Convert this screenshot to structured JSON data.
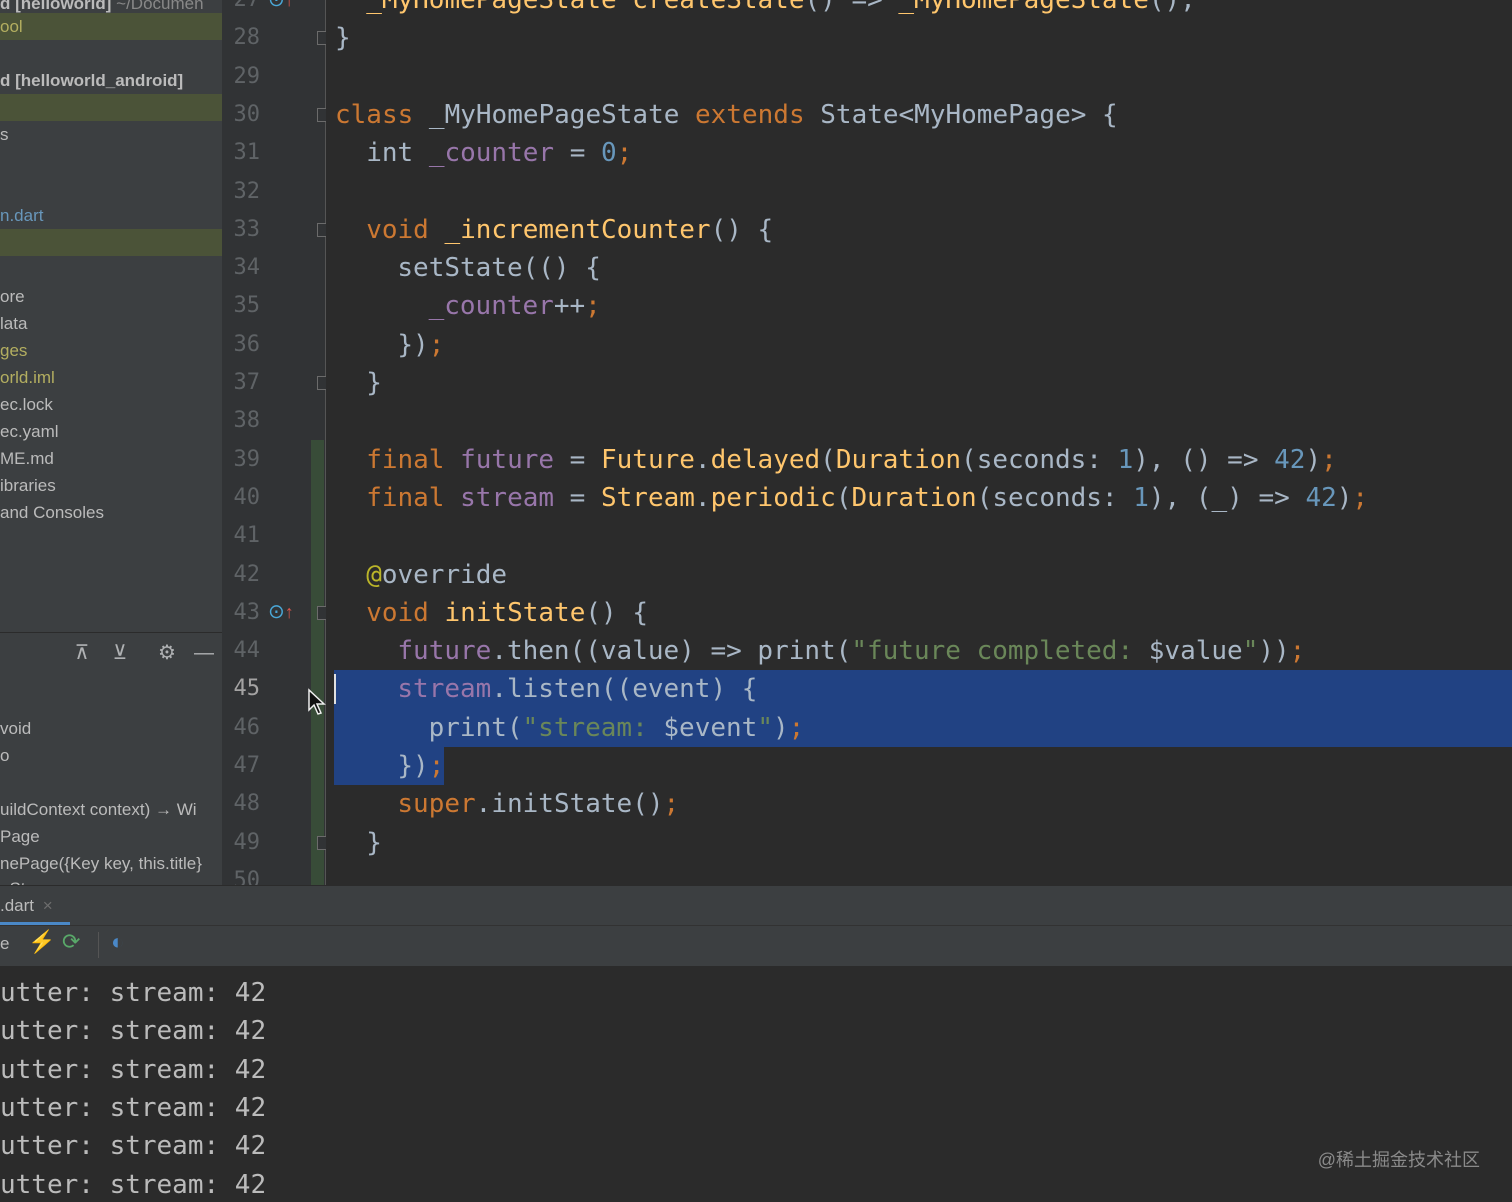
{
  "project_tree": [
    {
      "text": "d [helloworld]",
      "dim": " ~/Documen",
      "bold": true,
      "color": "#bbbbbb"
    },
    {
      "text": "ool",
      "color": "#b3ae60",
      "highlight": true
    },
    {
      "text": "d [helloworld_android]",
      "bold": true,
      "color": "#bbbbbb"
    },
    {
      "text": "",
      "highlight": true
    },
    {
      "text": "s",
      "color": "#bbbbbb"
    },
    {
      "text": "n.dart",
      "color": "#6897bb"
    },
    {
      "text": "",
      "highlight": true
    },
    {
      "text": "ore",
      "color": "#bbbbbb"
    },
    {
      "text": "lata",
      "color": "#bbbbbb"
    },
    {
      "text": "ges",
      "color": "#b3ae60"
    },
    {
      "text": "orld.iml",
      "color": "#b3ae60"
    },
    {
      "text": "ec.lock",
      "color": "#bbbbbb"
    },
    {
      "text": "ec.yaml",
      "color": "#bbbbbb"
    },
    {
      "text": "ME.md",
      "color": "#bbbbbb"
    },
    {
      "text": "ibraries",
      "color": "#bbbbbb"
    },
    {
      "text": " and Consoles",
      "color": "#bbbbbb"
    }
  ],
  "structure_toolbar": {
    "expand_icon": "⊼",
    "collapse_icon": "⊻",
    "settings_icon": "⚙",
    "hide_icon": "—"
  },
  "structure_items": [
    {
      "text": "void"
    },
    {
      "text": "o"
    },
    {
      "text": "uildContext context) → Wi"
    },
    {
      "text": "Page"
    },
    {
      "text": "nePage({Key key, this.title}"
    },
    {
      "text": "_St"
    }
  ],
  "line_numbers": [
    "27",
    "28",
    "29",
    "30",
    "31",
    "32",
    "33",
    "34",
    "35",
    "36",
    "37",
    "38",
    "39",
    "40",
    "41",
    "42",
    "43",
    "44",
    "45",
    "46",
    "47",
    "48",
    "49",
    "50"
  ],
  "current_line": "45",
  "code_lines": [
    {
      "indent": 1,
      "tokens": [
        [
          "fn",
          "_MyHomePageState "
        ],
        [
          "fn",
          "createState"
        ],
        [
          "p",
          "() => "
        ],
        [
          "fn",
          "_MyHomePageState"
        ],
        [
          "p",
          "();"
        ]
      ]
    },
    {
      "indent": 0,
      "tokens": [
        [
          "p",
          "}"
        ]
      ]
    },
    {
      "indent": 0,
      "tokens": []
    },
    {
      "indent": 0,
      "tokens": [
        [
          "kw",
          "class "
        ],
        [
          "p",
          "_MyHomePageState "
        ],
        [
          "kw",
          "extends "
        ],
        [
          "p",
          "State<MyHomePage> {"
        ]
      ]
    },
    {
      "indent": 1,
      "tokens": [
        [
          "p",
          "int "
        ],
        [
          "fld",
          "_counter"
        ],
        [
          "p",
          " = "
        ],
        [
          "num",
          "0"
        ],
        [
          "kw",
          ";"
        ]
      ]
    },
    {
      "indent": 0,
      "tokens": []
    },
    {
      "indent": 1,
      "tokens": [
        [
          "kw",
          "void "
        ],
        [
          "fn",
          "_incrementCounter"
        ],
        [
          "p",
          "() {"
        ]
      ]
    },
    {
      "indent": 2,
      "tokens": [
        [
          "p",
          "setState(() {"
        ]
      ]
    },
    {
      "indent": 3,
      "tokens": [
        [
          "fld",
          "_counter"
        ],
        [
          "p",
          "++"
        ],
        [
          "kw",
          ";"
        ]
      ]
    },
    {
      "indent": 2,
      "tokens": [
        [
          "p",
          "})"
        ],
        [
          "kw",
          ";"
        ]
      ]
    },
    {
      "indent": 1,
      "tokens": [
        [
          "p",
          "}"
        ]
      ]
    },
    {
      "indent": 0,
      "tokens": []
    },
    {
      "indent": 1,
      "tokens": [
        [
          "kw",
          "final "
        ],
        [
          "fld",
          "future"
        ],
        [
          "p",
          " = "
        ],
        [
          "fn",
          "Future"
        ],
        [
          "p",
          "."
        ],
        [
          "fn",
          "delayed"
        ],
        [
          "p",
          "("
        ],
        [
          "fn",
          "Duration"
        ],
        [
          "p",
          "(seconds: "
        ],
        [
          "num",
          "1"
        ],
        [
          "p",
          "), () => "
        ],
        [
          "num",
          "42"
        ],
        [
          "p",
          ")"
        ],
        [
          "kw",
          ";"
        ]
      ]
    },
    {
      "indent": 1,
      "tokens": [
        [
          "kw",
          "final "
        ],
        [
          "fld",
          "stream"
        ],
        [
          "p",
          " = "
        ],
        [
          "fn",
          "Stream"
        ],
        [
          "p",
          "."
        ],
        [
          "fn",
          "periodic"
        ],
        [
          "p",
          "("
        ],
        [
          "fn",
          "Duration"
        ],
        [
          "p",
          "(seconds: "
        ],
        [
          "num",
          "1"
        ],
        [
          "p",
          "), (_) => "
        ],
        [
          "num",
          "42"
        ],
        [
          "p",
          ")"
        ],
        [
          "kw",
          ";"
        ]
      ]
    },
    {
      "indent": 0,
      "tokens": []
    },
    {
      "indent": 1,
      "tokens": [
        [
          "ann",
          "@"
        ],
        [
          "p",
          "override"
        ]
      ]
    },
    {
      "indent": 1,
      "tokens": [
        [
          "kw",
          "void "
        ],
        [
          "fn",
          "initState"
        ],
        [
          "p",
          "() {"
        ]
      ]
    },
    {
      "indent": 2,
      "tokens": [
        [
          "fld",
          "future"
        ],
        [
          "p",
          ".then((value) => print("
        ],
        [
          "str",
          "\"future completed: "
        ],
        [
          "p",
          "$value"
        ],
        [
          "str",
          "\""
        ],
        [
          "p",
          "))"
        ],
        [
          "kw",
          ";"
        ]
      ]
    },
    {
      "indent": 2,
      "tokens": [
        [
          "fld",
          "stream"
        ],
        [
          "p",
          ".listen((event) {"
        ]
      ]
    },
    {
      "indent": 3,
      "tokens": [
        [
          "p",
          "print("
        ],
        [
          "str",
          "\"stream: "
        ],
        [
          "p",
          "$event"
        ],
        [
          "str",
          "\""
        ],
        [
          "p",
          ")"
        ],
        [
          "kw",
          ";"
        ]
      ]
    },
    {
      "indent": 2,
      "tokens": [
        [
          "p",
          "})"
        ],
        [
          "kw",
          ";"
        ]
      ]
    },
    {
      "indent": 2,
      "tokens": [
        [
          "kw",
          "super"
        ],
        [
          "p",
          ".initState()"
        ],
        [
          "kw",
          ";"
        ]
      ]
    },
    {
      "indent": 1,
      "tokens": [
        [
          "p",
          "}"
        ]
      ]
    },
    {
      "indent": 0,
      "tokens": []
    }
  ],
  "run_panel": {
    "tab_label": ".dart",
    "close_icon": "×",
    "toolbar_label": "e",
    "hot_reload_icon": "⚡",
    "hot_restart_icon": "⟳",
    "devtools_icon": "◐"
  },
  "console_lines": [
    "utter: stream: 42",
    "utter: stream: 42",
    "utter: stream: 42",
    "utter: stream: 42",
    "utter: stream: 42",
    "utter: stream: 42"
  ],
  "watermark": "@稀土掘金技术社区",
  "colors": {
    "selection": "#214283",
    "keyword": "#cc7832",
    "field": "#9876aa",
    "number": "#6897bb",
    "string": "#6a8759",
    "function": "#ffc66d"
  }
}
